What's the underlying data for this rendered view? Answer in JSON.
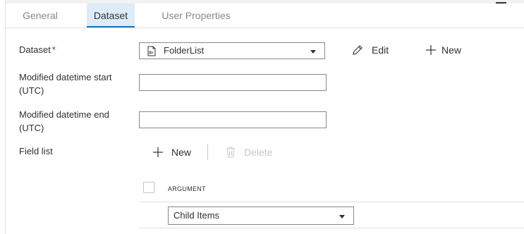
{
  "tabs": [
    {
      "label": "General",
      "active": false
    },
    {
      "label": "Dataset",
      "active": true
    },
    {
      "label": "User Properties",
      "active": false
    }
  ],
  "form": {
    "dataset": {
      "label": "Dataset",
      "required_marker": "*",
      "selected": "FolderList",
      "file_icon": "file-icon",
      "edit_label": "Edit",
      "edit_icon": "pencil-icon",
      "new_label": "New",
      "new_icon": "plus-icon"
    },
    "modified_start": {
      "label_line1": "Modified datetime start",
      "label_line2": "(UTC)",
      "value": ""
    },
    "modified_end": {
      "label_line1": "Modified datetime end",
      "label_line2": "(UTC)",
      "value": ""
    },
    "field_list": {
      "label": "Field list",
      "new_label": "New",
      "new_icon": "plus-icon",
      "delete_label": "Delete",
      "delete_icon": "trash-icon",
      "column_header": "ARGUMENT",
      "rows": [
        {
          "argument": "Child Items"
        }
      ]
    }
  },
  "colors": {
    "accent": "#0078d4",
    "tab_active_bg": "#deecf9",
    "required": "#a4262c",
    "disabled": "#c8c6c4"
  }
}
